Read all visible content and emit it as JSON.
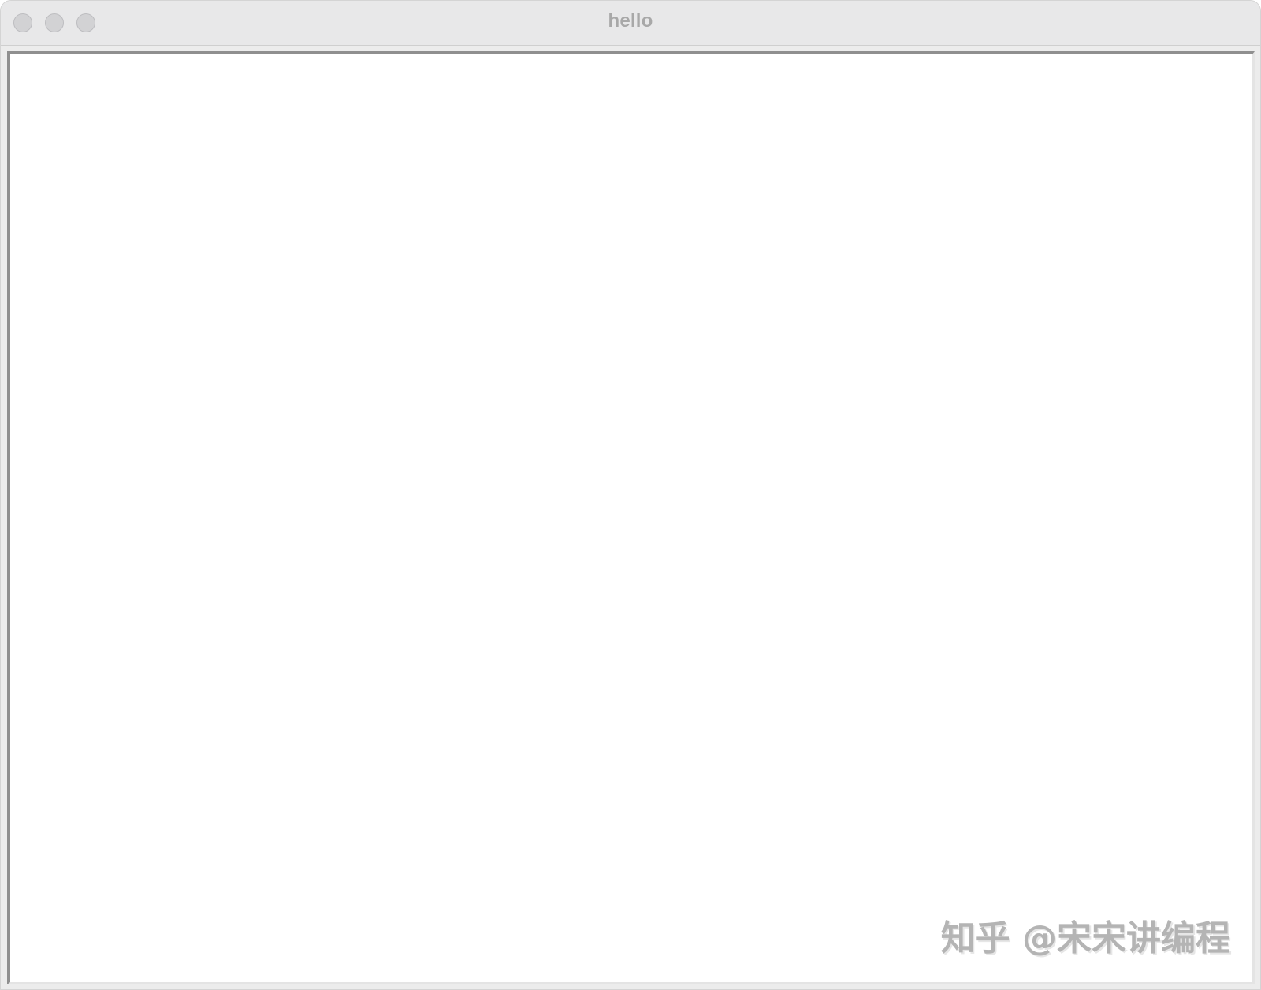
{
  "window": {
    "title": "hello",
    "controls": [
      {
        "name": "close",
        "icon": "traffic-light-close"
      },
      {
        "name": "minimize",
        "icon": "traffic-light-minimize"
      },
      {
        "name": "zoom",
        "icon": "traffic-light-zoom"
      }
    ],
    "control_color": "#d2d2d4"
  },
  "canvas": {
    "background": "#ffffff"
  },
  "watermark": {
    "text": "知乎 @宋宋讲编程"
  }
}
